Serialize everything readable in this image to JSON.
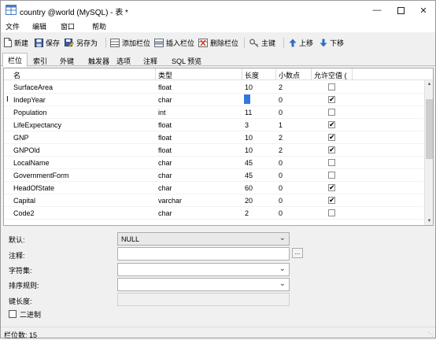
{
  "window": {
    "title": "country @world (MySQL) - 表 *"
  },
  "menu": {
    "items": [
      "文件",
      "编辑",
      "窗口",
      "帮助"
    ]
  },
  "toolbar": {
    "new": "新建",
    "save": "保存",
    "save_as": "另存为",
    "add_field": "添加栏位",
    "insert_field": "插入栏位",
    "delete_field": "删除栏位",
    "primary_key": "主键",
    "move_up": "上移",
    "move_down": "下移"
  },
  "tabs": [
    "栏位",
    "索引",
    "外键",
    "触发器",
    "选项",
    "注释",
    "SQL 预览"
  ],
  "grid": {
    "columns": [
      "名",
      "类型",
      "长度",
      "小数点",
      "允许空值 ("
    ],
    "rows": [
      {
        "name": "SurfaceArea",
        "type": "float",
        "length": "10",
        "decimals": "2",
        "nullable": false
      },
      {
        "name": "IndepYear",
        "type": "char",
        "length": "",
        "decimals": "0",
        "nullable": true
      },
      {
        "name": "Population",
        "type": "int",
        "length": "11",
        "decimals": "0",
        "nullable": false
      },
      {
        "name": "LifeExpectancy",
        "type": "float",
        "length": "3",
        "decimals": "1",
        "nullable": true
      },
      {
        "name": "GNP",
        "type": "float",
        "length": "10",
        "decimals": "2",
        "nullable": true
      },
      {
        "name": "GNPOld",
        "type": "float",
        "length": "10",
        "decimals": "2",
        "nullable": true
      },
      {
        "name": "LocalName",
        "type": "char",
        "length": "45",
        "decimals": "0",
        "nullable": false
      },
      {
        "name": "GovernmentForm",
        "type": "char",
        "length": "45",
        "decimals": "0",
        "nullable": false
      },
      {
        "name": "HeadOfState",
        "type": "char",
        "length": "60",
        "decimals": "0",
        "nullable": true
      },
      {
        "name": "Capital",
        "type": "varchar",
        "length": "20",
        "decimals": "0",
        "nullable": true
      },
      {
        "name": "Code2",
        "type": "char",
        "length": "2",
        "decimals": "0",
        "nullable": false
      }
    ],
    "current_row_marker": "I"
  },
  "properties": {
    "default_label": "默认:",
    "default_value": "NULL",
    "comment_label": "注释:",
    "comment_value": "",
    "comment_button": "...",
    "charset_label": "字符集:",
    "charset_value": "",
    "collation_label": "排序规则:",
    "collation_value": "",
    "key_length_label": "键长度:",
    "key_length_value": "",
    "binary_label": "二进制"
  },
  "status": {
    "text": "栏位数: 15"
  },
  "colors": {
    "selection": "#3377dd",
    "window_bg": "#f0f0f0"
  },
  "icons": {
    "title": "table-icon",
    "new": "new-file-icon",
    "save": "save-disk-icon",
    "save_as": "save-as-icon",
    "add_field": "add-field-icon",
    "insert_field": "insert-field-icon",
    "delete_field": "delete-field-icon",
    "primary_key": "key-icon",
    "move_up": "arrow-up-icon",
    "move_down": "arrow-down-icon"
  }
}
